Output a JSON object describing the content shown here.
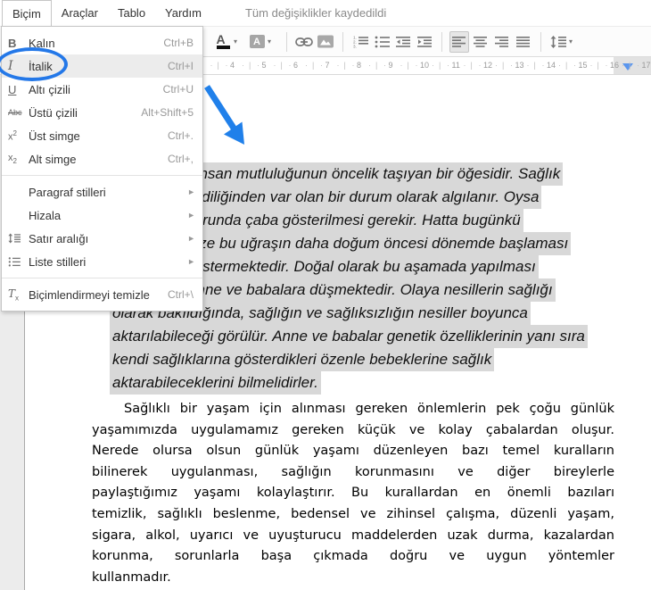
{
  "colors": {
    "annotation_blue": "#2478e8",
    "selection_gray": "#d8d8d8",
    "ruler_marker_blue": "#5a96ee"
  },
  "menu_bar": {
    "items": [
      {
        "label": "Biçim",
        "open": true
      },
      {
        "label": "Araçlar",
        "open": false
      },
      {
        "label": "Tablo",
        "open": false
      },
      {
        "label": "Yardım",
        "open": false
      }
    ],
    "status": "Tüm değişiklikler kaydedildi"
  },
  "format_menu": {
    "items": [
      {
        "type": "item",
        "icon": "bold-icon",
        "label": "Kalın",
        "shortcut": "Ctrl+B",
        "hover": false,
        "submenu": false
      },
      {
        "type": "item",
        "icon": "italic-icon",
        "label": "İtalik",
        "shortcut": "Ctrl+I",
        "hover": true,
        "submenu": false
      },
      {
        "type": "item",
        "icon": "underline-icon",
        "label": "Altı çizili",
        "shortcut": "Ctrl+U",
        "hover": false,
        "submenu": false
      },
      {
        "type": "item",
        "icon": "strikethrough-icon",
        "label": "Üstü çizili",
        "shortcut": "Alt+Shift+5",
        "hover": false,
        "submenu": false
      },
      {
        "type": "item",
        "icon": "superscript-icon",
        "label": "Üst simge",
        "shortcut": "Ctrl+.",
        "hover": false,
        "submenu": false
      },
      {
        "type": "item",
        "icon": "subscript-icon",
        "label": "Alt simge",
        "shortcut": "Ctrl+,",
        "hover": false,
        "submenu": false
      },
      {
        "type": "separator"
      },
      {
        "type": "item",
        "icon": "",
        "label": "Paragraf stilleri",
        "shortcut": "",
        "hover": false,
        "submenu": true
      },
      {
        "type": "item",
        "icon": "",
        "label": "Hizala",
        "shortcut": "",
        "hover": false,
        "submenu": true
      },
      {
        "type": "item",
        "icon": "line-spacing-icon",
        "label": "Satır aralığı",
        "shortcut": "",
        "hover": false,
        "submenu": true
      },
      {
        "type": "item",
        "icon": "list-styles-icon",
        "label": "Liste stilleri",
        "shortcut": "",
        "hover": false,
        "submenu": true
      },
      {
        "type": "separator"
      },
      {
        "type": "item",
        "icon": "clear-formatting-icon",
        "label": "Biçimlendirmeyi temizle",
        "shortcut": "Ctrl+\\",
        "hover": false,
        "submenu": false
      }
    ]
  },
  "toolbar": {
    "buttons": [
      {
        "icon": "text-color-icon",
        "active": false
      },
      {
        "icon": "caret-down-icon",
        "active": false
      },
      {
        "icon": "highlight-color-icon",
        "active": false
      },
      {
        "icon": "caret-down-icon",
        "active": false
      },
      {
        "icon": "separator"
      },
      {
        "icon": "insert-link-icon",
        "active": false
      },
      {
        "icon": "insert-image-icon",
        "active": false
      },
      {
        "icon": "separator"
      },
      {
        "icon": "numbered-list-icon",
        "active": false
      },
      {
        "icon": "bullet-list-icon",
        "active": false
      },
      {
        "icon": "outdent-icon",
        "active": false
      },
      {
        "icon": "indent-icon",
        "active": false
      },
      {
        "icon": "separator"
      },
      {
        "icon": "align-left-icon",
        "active": true
      },
      {
        "icon": "align-center-icon",
        "active": false
      },
      {
        "icon": "align-right-icon",
        "active": false
      },
      {
        "icon": "justify-icon",
        "active": false
      },
      {
        "icon": "separator"
      },
      {
        "icon": "line-spacing-icon",
        "active": false
      },
      {
        "icon": "caret-down-icon",
        "active": false
      }
    ]
  },
  "ruler": {
    "first_number": 3,
    "last_number": 17,
    "marker_at_number": 16.45
  },
  "document": {
    "paragraph1": {
      "style": "italic",
      "selected": true,
      "lines": [
        "Sağlık, insan mutluluğunun öncelik taşıyan bir öğesidir. Sağlık",
        "çoğu kez kendiliğinden var olan bir durum olarak algılanır. Oysa",
        "sağlığımız uğrunda çaba gösterilmesi gerekir. Hatta bugünkü",
        "bilgilerimiz bize bu uğraşın daha doğum öncesi dönemde başlaması",
        "gerektiğini göstermektedir. Doğal olarak bu aşamada yapılması",
        "gerekenler anne ve babalara düşmektedir. Olaya nesillerin sağlığı",
        "olarak bakıldığında, sağlığın ve sağlıksızlığın nesiller boyunca",
        "aktarılabileceği görülür. Anne ve babalar genetik özelliklerinin yanı sıra",
        "kendi sağlıklarına gösterdikleri özenle bebeklerine sağlık",
        "aktarabileceklerini bilmelidirler."
      ]
    },
    "paragraph2": {
      "style": "regular",
      "selected": false,
      "lines": [
        "Sağlıklı bir yaşam için alınması gereken önlemlerin pek çoğu günlük",
        "yaşamımızda  uygulamamız gereken küçük ve kolay çabalardan oluşur.",
        "Nerede olursa olsun günlük yaşamı düzenleyen bazı temel kuralların",
        "bilinerek uygulanması, sağlığın korunmasını ve diğer bireylerle",
        "paylaştığımız yaşamı kolaylaştırır. Bu kurallardan en önemli bazıları",
        "temizlik, sağlıklı beslenme, bedensel ve zihinsel çalışma, düzenli yaşam,",
        "sigara, alkol, uyarıcı ve uyuşturucu maddelerden uzak durma, kazalardan",
        "korunma, sorunlarla başa çıkmada doğru ve uygun yöntemler",
        "kullanmadır."
      ]
    }
  }
}
